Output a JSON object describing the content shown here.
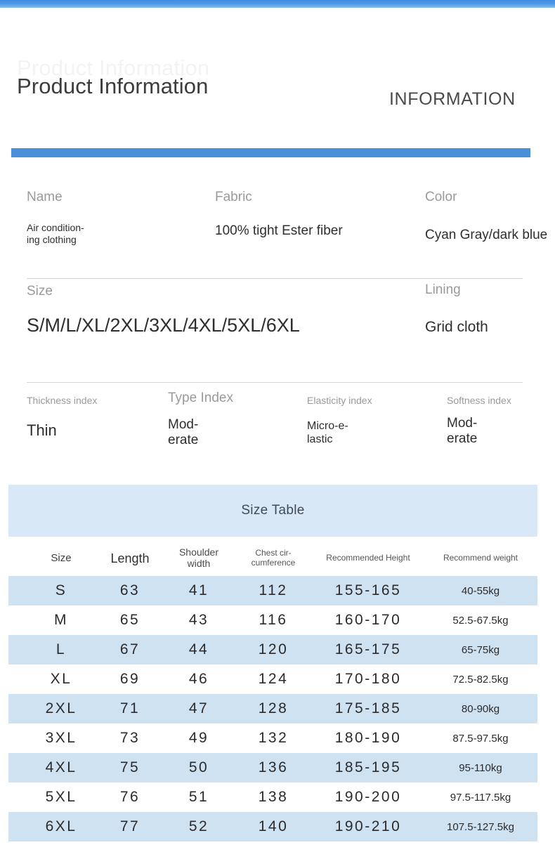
{
  "header": {
    "title": "Product Information",
    "ghost_title": "Product Information",
    "subtitle": "INFORMATION",
    "accent_color": "#4a90d9",
    "top_bar_color": "#4e98e3"
  },
  "specs": {
    "row1": [
      {
        "label": "Name",
        "value": "Air condition-\ning clothing"
      },
      {
        "label": "Fabric",
        "value": "100% tight Ester fiber"
      },
      {
        "label": "Color",
        "value": "Cyan Gray/dark blue"
      }
    ],
    "row2": [
      {
        "label": "Size",
        "value": "S/M/L/XL/2XL/3XL/4XL/5XL/6XL"
      },
      {
        "label": "Lining",
        "value": "Grid cloth"
      }
    ],
    "row3": [
      {
        "label": "Thickness index",
        "value": "Thin"
      },
      {
        "label": "Type Index",
        "value": "Mod-\nerate"
      },
      {
        "label": "Elasticity index",
        "value": "Micro-e-\nlastic"
      },
      {
        "label": "Softness index",
        "value": "Mod-\nerate"
      }
    ]
  },
  "size_table": {
    "banner": "Size Table",
    "banner_color": "#d8e8f7",
    "stripe_color": "#cfe2f2",
    "columns": [
      "Size",
      "Length",
      "Shoulder\nwidth",
      "Chest cir-\ncumference",
      "Recommended Height",
      "Recommend weight"
    ],
    "rows": [
      {
        "size": "S",
        "length": "63",
        "shoulder": "41",
        "chest": "112",
        "height": "155-165",
        "weight": "40-55kg"
      },
      {
        "size": "M",
        "length": "65",
        "shoulder": "43",
        "chest": "116",
        "height": "160-170",
        "weight": "52.5-67.5kg"
      },
      {
        "size": "L",
        "length": "67",
        "shoulder": "44",
        "chest": "120",
        "height": "165-175",
        "weight": "65-75kg"
      },
      {
        "size": "XL",
        "length": "69",
        "shoulder": "46",
        "chest": "124",
        "height": "170-180",
        "weight": "72.5-82.5kg"
      },
      {
        "size": "2XL",
        "length": "71",
        "shoulder": "47",
        "chest": "128",
        "height": "175-185",
        "weight": "80-90kg"
      },
      {
        "size": "3XL",
        "length": "73",
        "shoulder": "49",
        "chest": "132",
        "height": "180-190",
        "weight": "87.5-97.5kg"
      },
      {
        "size": "4XL",
        "length": "75",
        "shoulder": "50",
        "chest": "136",
        "height": "185-195",
        "weight": "95-110kg"
      },
      {
        "size": "5XL",
        "length": "76",
        "shoulder": "51",
        "chest": "138",
        "height": "190-200",
        "weight": "97.5-117.5kg"
      },
      {
        "size": "6XL",
        "length": "77",
        "shoulder": "52",
        "chest": "140",
        "height": "190-210",
        "weight": "107.5-127.5kg"
      }
    ]
  }
}
